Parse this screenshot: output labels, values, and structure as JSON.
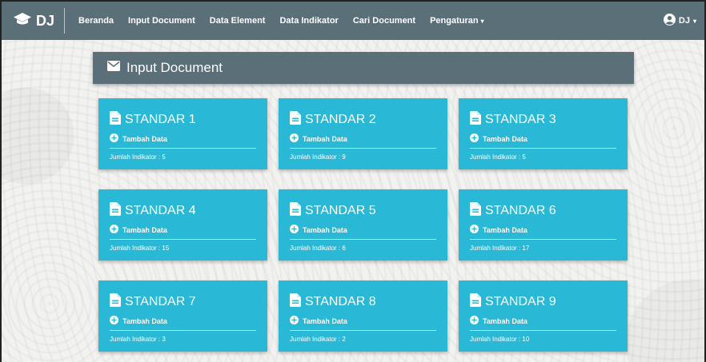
{
  "brand": {
    "name": "DJ"
  },
  "nav": {
    "items": [
      {
        "label": "Beranda"
      },
      {
        "label": "Input Document"
      },
      {
        "label": "Data Element"
      },
      {
        "label": "Data Indikator"
      },
      {
        "label": "Cari Document"
      },
      {
        "label": "Pengaturan"
      }
    ],
    "user_label": "DJ"
  },
  "header": {
    "title": "Input Document"
  },
  "cards": [
    {
      "title": "STANDAR 1",
      "add_label": "Tambah Data",
      "count_label": "Jumlah Indikator : 5"
    },
    {
      "title": "STANDAR 2",
      "add_label": "Tambah Data",
      "count_label": "Jumlah Indikator : 9"
    },
    {
      "title": "STANDAR 3",
      "add_label": "Tambah Data",
      "count_label": "Jumlah Indikator : 5"
    },
    {
      "title": "STANDAR 4",
      "add_label": "Tambah Data",
      "count_label": "Jumlah Indikator : 15"
    },
    {
      "title": "STANDAR 5",
      "add_label": "Tambah Data",
      "count_label": "Jumlah Indikator : 6"
    },
    {
      "title": "STANDAR 6",
      "add_label": "Tambah Data",
      "count_label": "Jumlah Indikator : 17"
    },
    {
      "title": "STANDAR 7",
      "add_label": "Tambah Data",
      "count_label": "Jumlah Indikator : 3"
    },
    {
      "title": "STANDAR 8",
      "add_label": "Tambah Data",
      "count_label": "Jumlah Indikator : 2"
    },
    {
      "title": "STANDAR 9",
      "add_label": "Tambah Data",
      "count_label": "Jumlah Indikator : 10"
    }
  ],
  "colors": {
    "navbar": "#5b6f78",
    "card": "#29b8d6",
    "background": "#f2f2f0"
  },
  "icons": {
    "brand": "graduation-cap-icon",
    "header": "envelope-icon",
    "card_title": "file-icon",
    "card_add": "plus-circle-icon",
    "user": "user-circle-icon"
  }
}
